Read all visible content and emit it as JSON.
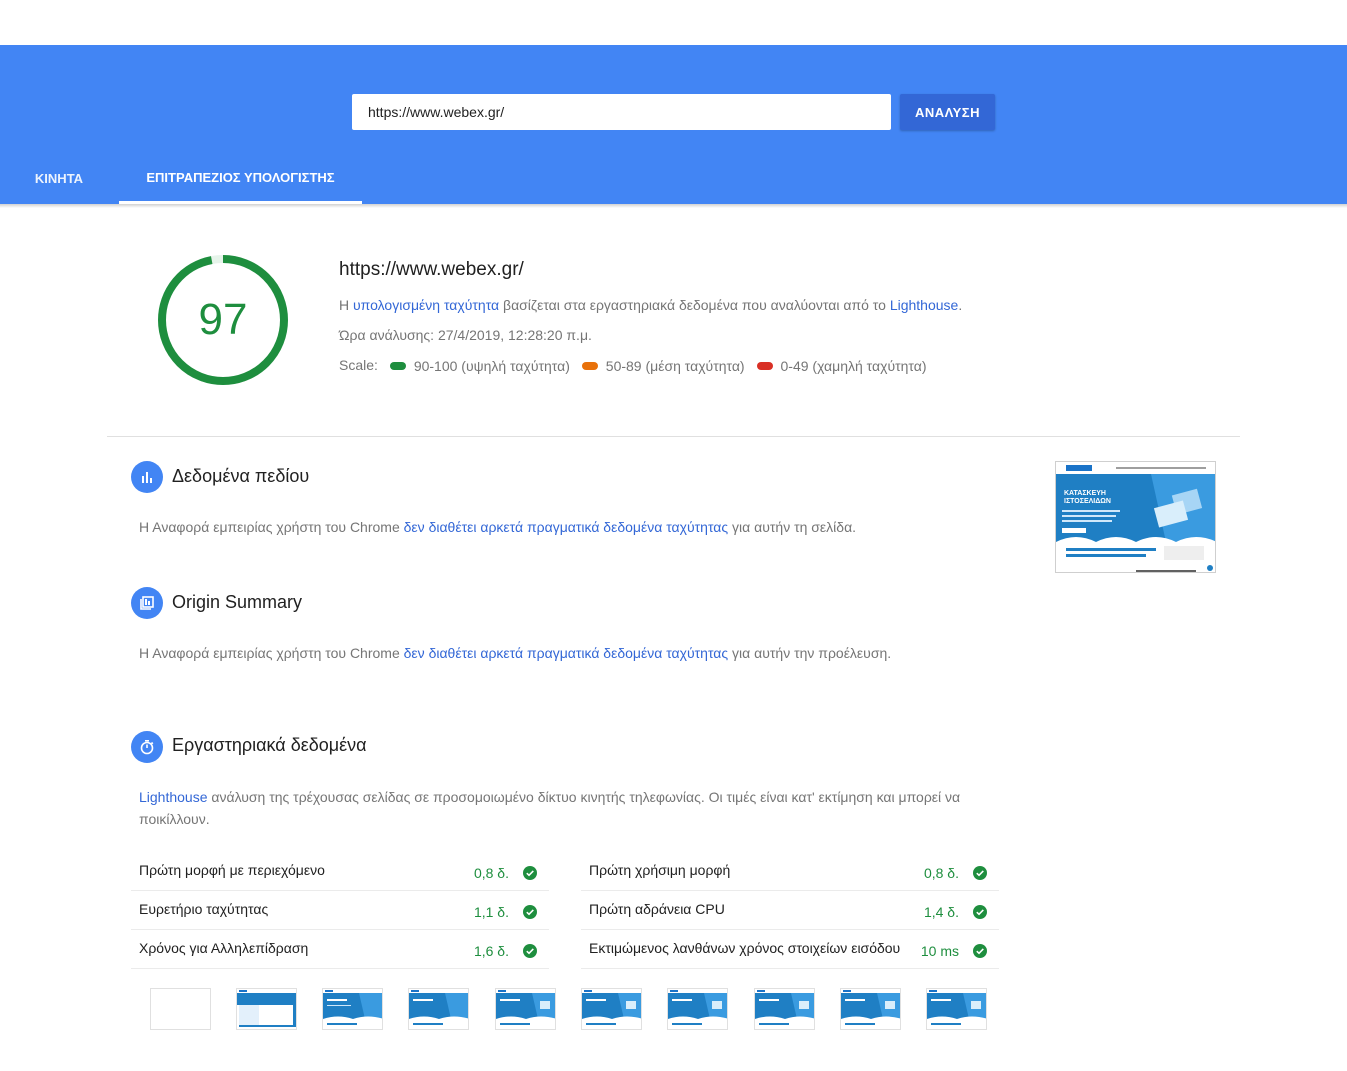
{
  "header": {
    "url_value": "https://www.webex.gr/",
    "analyze_label": "ΑΝΑΛΥΣΗ",
    "tabs": [
      "ΚΙΝΗΤΑ",
      "ΕΠΙΤΡΑΠΕΖΙΟΣ ΥΠΟΛΟΓΙΣΤΗΣ"
    ],
    "active_tab": "ΕΠΙΤΡΑΠΕΖΙΟΣ ΥΠΟΛΟΓΙΣΤΗΣ"
  },
  "summary": {
    "score": "97",
    "score_fraction": 0.97,
    "url": "https://www.webex.gr/",
    "estimated_prefix": "Η ",
    "estimated_link": "υπολογισμένη ταχύτητα",
    "estimated_middle": " βασίζεται στα εργαστηριακά δεδομένα που αναλύονται από το ",
    "lighthouse_link": "Lighthouse",
    "estimated_suffix": ".",
    "analysis_time": "Ώρα ανάλυσης: 27/4/2019, 12:28:20 π.μ.",
    "scale_label": "Scale:",
    "scale": [
      {
        "label": "90-100 (υψηλή ταχύτητα)",
        "color": "#1e8e3e"
      },
      {
        "label": "50-89 (μέση ταχύτητα)",
        "color": "#e8710a"
      },
      {
        "label": "0-49 (χαμηλή ταχύτητα)",
        "color": "#d93025"
      }
    ]
  },
  "field_data": {
    "title": "Δεδομένα πεδίου",
    "text_prefix": "Η Αναφορά εμπειρίας χρήστη του Chrome ",
    "text_link": "δεν διαθέτει αρκετά πραγματικά δεδομένα ταχύτητας",
    "text_suffix": " για αυτήν τη σελίδα."
  },
  "origin_summary": {
    "title": "Origin Summary",
    "text_prefix": "Η Αναφορά εμπειρίας χρήστη του Chrome ",
    "text_link": "δεν διαθέτει αρκετά πραγματικά δεδομένα ταχύτητας",
    "text_suffix": " για αυτήν την προέλευση."
  },
  "lab_data": {
    "title": "Εργαστηριακά δεδομένα",
    "text_link": "Lighthouse",
    "text_rest": " ανάλυση της τρέχουσας σελίδας σε προσομοιωμένο δίκτυο κινητής τηλεφωνίας. Οι τιμές είναι κατ' εκτίμηση και μπορεί να ποικίλλουν.",
    "metrics": [
      {
        "label": "Πρώτη μορφή με περιεχόμενο",
        "value": "0,8 δ."
      },
      {
        "label": "Πρώτη χρήσιμη μορφή",
        "value": "0,8 δ."
      },
      {
        "label": "Ευρετήριο ταχύτητας",
        "value": "1,1 δ."
      },
      {
        "label": "Πρώτη αδράνεια CPU",
        "value": "1,4 δ."
      },
      {
        "label": "Χρόνος για Αλληλεπίδραση",
        "value": "1,6 δ."
      },
      {
        "label": "Εκτιμώμενος λανθάνων χρόνος στοιχείων εισόδου",
        "value": "10 ms"
      }
    ]
  },
  "screenshot_thumb": {
    "heading_line1": "ΚΑΤΑΣΚΕΥΗ",
    "heading_line2": "ΙΣΤΟΣΕΛΙΔΩΝ"
  },
  "colors": {
    "header_blue": "#4285f4",
    "button_blue": "#3367d6",
    "pass_green": "#1e8e3e"
  }
}
